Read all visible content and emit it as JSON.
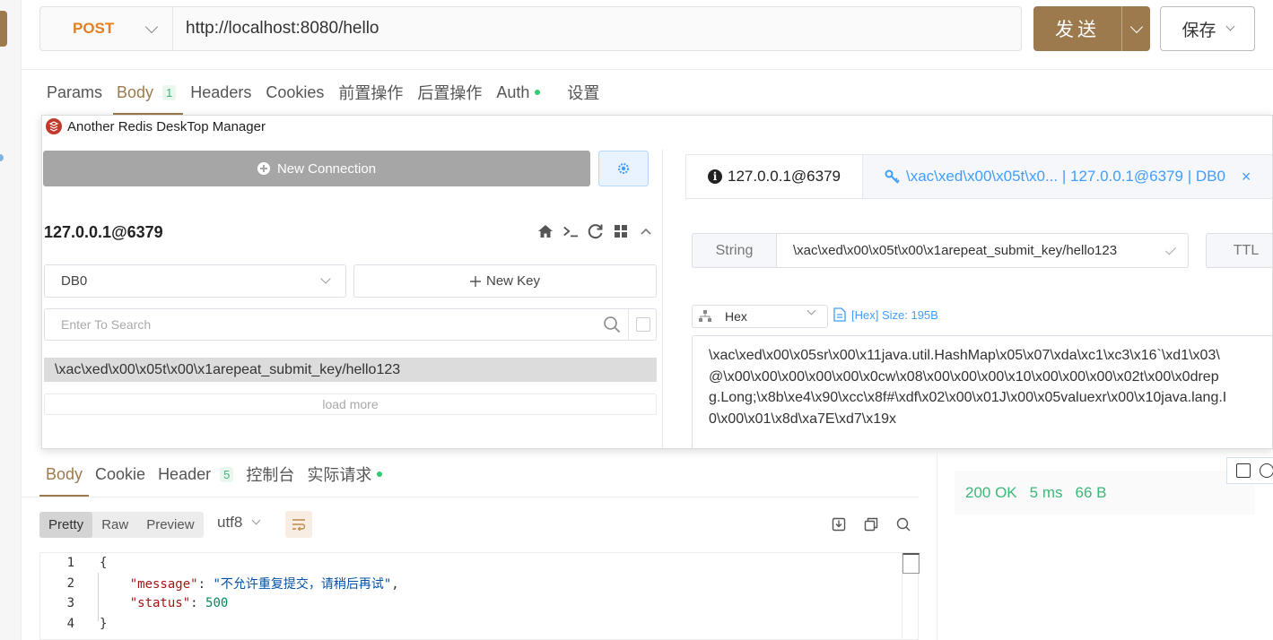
{
  "request": {
    "method": "POST",
    "url": "http://localhost:8080/hello",
    "send_label": "发送",
    "save_label": "保存"
  },
  "request_tabs": {
    "params": "Params",
    "body": "Body",
    "body_count": "1",
    "headers": "Headers",
    "cookies": "Cookies",
    "pre_script": "前置操作",
    "post_script": "后置操作",
    "auth": "Auth",
    "settings": "设置"
  },
  "redis": {
    "window_title": "Another Redis DeskTop Manager",
    "new_connection": "New Connection",
    "connection_name": "127.0.0.1@6379",
    "db_select": "DB0",
    "new_key": "New Key",
    "search_placeholder": "Enter To Search",
    "keys": [
      "\\xac\\xed\\x00\\x05t\\x00\\x1arepeat_submit_key/hello123"
    ],
    "load_more": "load more",
    "tab_info": "127.0.0.1@6379",
    "tab_key": "\\xac\\xed\\x00\\x05t\\x0... | 127.0.0.1@6379 | DB0",
    "key_type": "String",
    "key_name": "\\xac\\xed\\x00\\x05t\\x00\\x1arepeat_submit_key/hello123",
    "ttl_label": "TTL",
    "format": "Hex",
    "size_info": "[Hex] Size: 195B",
    "value_lines": [
      "\\xac\\xed\\x00\\x05sr\\x00\\x11java.util.HashMap\\x05\\x07\\xda\\xc1\\xc3\\x16`\\xd1\\x03\\",
      "@\\x00\\x00\\x00\\x00\\x00\\x0cw\\x08\\x00\\x00\\x00\\x10\\x00\\x00\\x00\\x02t\\x00\\x0drep",
      "g.Long;\\x8b\\xe4\\x90\\xcc\\x8f#\\xdf\\x02\\x00\\x01J\\x00\\x05valuexr\\x00\\x10java.lang.I",
      "0\\x00\\x01\\x8d\\xa7E\\xd7\\x19x"
    ]
  },
  "response_tabs": {
    "body": "Body",
    "cookie": "Cookie",
    "header": "Header",
    "header_count": "5",
    "console": "控制台",
    "actual_request": "实际请求"
  },
  "response": {
    "formats": [
      "Pretty",
      "Raw",
      "Preview"
    ],
    "encoding": "utf8",
    "status": "200 OK",
    "time": "5 ms",
    "size": "66 B",
    "line_numbers": [
      "1",
      "2",
      "3",
      "4"
    ],
    "json_open": "{",
    "json_close": "}",
    "message_key": "\"message\"",
    "message_value": "\"不允许重复提交，请稍后再试\"",
    "status_key": "\"status\"",
    "status_value": "500"
  },
  "colors": {
    "accent": "#9c7a4e",
    "method": "#e67e22",
    "link_blue": "#409eff",
    "success_green": "#3cb878"
  }
}
